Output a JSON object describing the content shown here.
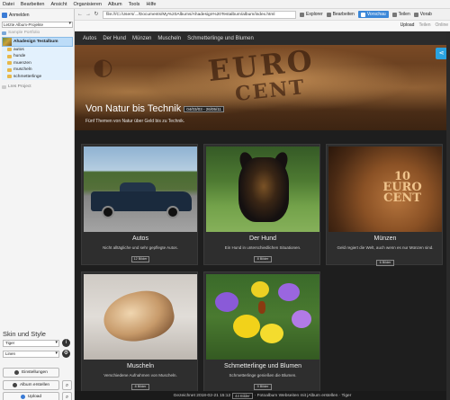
{
  "menubar": [
    "Datei",
    "Bearbeiten",
    "Ansicht",
    "Organisieren",
    "Album",
    "Tools",
    "Hilfe"
  ],
  "left": {
    "login_label": "Anmelden",
    "recent_dropdown": "Letzte Album-Projekte",
    "tree": {
      "portfolio": "Sample Portfolio",
      "album": "Ahadesign Testalbum",
      "subfolders": [
        "autos",
        "hunde",
        "muenzen",
        "muscheln",
        "schmetterlinge"
      ],
      "lres": "Lres Project"
    },
    "skin_title": "Skin und Style",
    "skin_select": "Tiger",
    "style_select": "Linen",
    "settings_button": "Einstellungen",
    "create_album_button": "Album erstellen",
    "upload_button": "Upload"
  },
  "browser": {
    "url": "file:///C:/Users/.../Documents/My%20Albums/Ahadesign%20Testalbum/album/index.html",
    "toolbar_buttons": [
      "Explorer",
      "Bearbeiten",
      "Vorschau",
      "Teilen",
      "Vorab"
    ],
    "active_button": "Vorschau",
    "toolbar2": [
      "Upload",
      "Teilen",
      "Online"
    ]
  },
  "page": {
    "nav": [
      "Autos",
      "Der Hund",
      "Münzen",
      "Muscheln",
      "Schmetterlinge und Blumen"
    ],
    "hero_title": "Von Natur bis Technik",
    "hero_date": "04/03/03 - 26/05/11",
    "hero_subtitle": "Fünf Themen von Natur über Geld bis zu Technik.",
    "coin_text": "EURO",
    "coin_text2": "CENT",
    "cards": [
      {
        "title": "Autos",
        "desc": "Nicht alltägliche und sehr gepflegte Autos.",
        "count": "12 Bilder"
      },
      {
        "title": "Der Hund",
        "desc": "Ein Hund in unterschiedlichen Situationen.",
        "count": "8 Bilder"
      },
      {
        "title": "Münzen",
        "desc": "Geld regiert die Welt, auch wenn es nur Münzen sind.",
        "count": "6 Bilder"
      },
      {
        "title": "Muscheln",
        "desc": "Verschiedene Aufnahmen von Muscheln.",
        "count": "8 Bilder"
      },
      {
        "title": "Schmetterlinge und Blumen",
        "desc": "Schmetterlinge genießen die Blumen.",
        "count": "9 Bilder"
      }
    ],
    "coin_card_text": "10 EURO CENT",
    "footer": {
      "created": "Gezeichnet 2018-02-21 15:12",
      "count": "44 Bilder",
      "credit": "· Fotoalbum Webseiten mit jAlbum erstellen · Tiger"
    }
  }
}
